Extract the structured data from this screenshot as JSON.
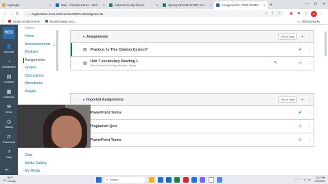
{
  "browser": {
    "tabs": [
      {
        "label": "MyEagle",
        "color": "#e8a33c",
        "active": false
      },
      {
        "label": "Mail - Claudia.Perez - Outlook",
        "color": "#0f6cbd",
        "active": false
      },
      {
        "label": "Adjunct faculty bitcoin",
        "color": "#1e7e45",
        "active": false
      },
      {
        "label": "Spring 2023 MASTER SHEET",
        "color": "#1e7e45",
        "active": false
      },
      {
        "label": "Assignments: 7252-COMG-",
        "color": "#2b5ea8",
        "active": true
      }
    ],
    "new_tab": "+",
    "url": "eagleonline.hccs.edu/courses/287146/assignments",
    "bookmarks": [
      {
        "label": "Adobe Acrobat Home",
        "color": "#d4282b"
      },
      {
        "label": "My Workaway acco...",
        "color": "#3a6fb0"
      }
    ],
    "all_bookmarks": "All Bookmarks",
    "profile_letter": "C"
  },
  "global_nav": {
    "logo": "HCC",
    "items": [
      {
        "label": "Account",
        "icon": "👤"
      },
      {
        "label": "Dashboard",
        "icon": "◔"
      },
      {
        "label": "Courses",
        "icon": "▤"
      },
      {
        "label": "Calendar",
        "icon": "▦"
      },
      {
        "label": "Inbox",
        "icon": "✉"
      },
      {
        "label": "History",
        "icon": "◷"
      },
      {
        "label": "Commons",
        "icon": "⇄"
      },
      {
        "label": "Help",
        "icon": "?"
      }
    ],
    "collapse": "⇤"
  },
  "course_nav": {
    "term": "FRANCE",
    "items": [
      {
        "label": "Home",
        "active": false,
        "hidden": false
      },
      {
        "label": "Announcements",
        "active": false,
        "hidden": true
      },
      {
        "label": "Modules",
        "active": false,
        "hidden": false
      },
      {
        "label": "Assignments",
        "active": true,
        "hidden": false
      },
      {
        "label": "Grades",
        "active": false,
        "hidden": false
      },
      {
        "label": "Discussions",
        "active": false,
        "hidden": false
      },
      {
        "label": "Attendance",
        "active": false,
        "hidden": false
      },
      {
        "label": "People",
        "active": false,
        "hidden": false
      }
    ],
    "bottom_items": [
      "Chat",
      "Media Gallery",
      "My Media"
    ]
  },
  "groups": [
    {
      "title": "Assignments",
      "percent": "0% of Total",
      "rows": [
        {
          "title": "Practice: Is This Citation Correct?",
          "sub": "",
          "published": true
        },
        {
          "title": "Unit 7 vocabulary Reading 1",
          "sub": "New Content From App Module  |  18 pts",
          "published": false
        }
      ]
    },
    {
      "title": "Imported Assignments",
      "percent": "0% of Total",
      "rows": [
        {
          "title": "PowerPoint Terms",
          "sub": "",
          "published": true
        },
        {
          "title": "Plagiarism Quiz",
          "sub": "",
          "published": false
        },
        {
          "title": "PowerPoint Terms",
          "sub": "",
          "published": false
        }
      ]
    }
  ],
  "taskbar": {
    "weather_temp": "85°F",
    "weather_desc": "Cloudy",
    "search_placeholder": "Search",
    "apps": [
      "#f2b01e",
      "#2270d1",
      "#0f6cbd",
      "#1e7e45",
      "#d4282b",
      "#1a73e8",
      "#7b68ee",
      "#ffffff",
      "#4b8bf5"
    ],
    "time": "3:47 PM",
    "date": "1/16/2025"
  }
}
